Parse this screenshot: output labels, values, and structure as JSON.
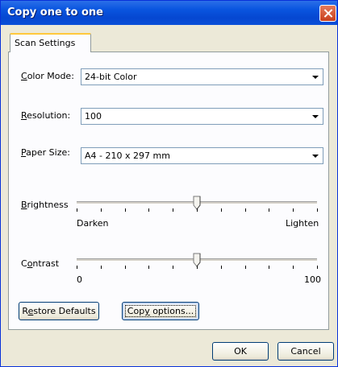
{
  "window": {
    "title": "Copy one to one"
  },
  "tabs": [
    {
      "label": "Scan Settings"
    }
  ],
  "fields": {
    "color_mode": {
      "label_u": "C",
      "label_rest": "olor Mode:",
      "value": "24-bit Color"
    },
    "resolution": {
      "label_u": "R",
      "label_rest": "esolution:",
      "value": "100"
    },
    "paper_size": {
      "label_u": "P",
      "label_rest": "aper Size:",
      "value": "A4 - 210 x 297 mm"
    }
  },
  "brightness": {
    "label_u": "B",
    "label_rest": "rightness",
    "min_label": "Darken",
    "max_label": "Lighten",
    "value_fraction": 0.5
  },
  "contrast": {
    "label_pre": "C",
    "label_u": "o",
    "label_rest": "ntrast",
    "min_label": "0",
    "max_label": "100",
    "value": 50
  },
  "buttons": {
    "restore": {
      "label_pre": "R",
      "label_u": "e",
      "label_rest": "store Defaults"
    },
    "copy_options": {
      "label_pre": "Cop",
      "label_u": "y",
      "label_rest": " options..."
    },
    "ok": "OK",
    "cancel": "Cancel"
  }
}
